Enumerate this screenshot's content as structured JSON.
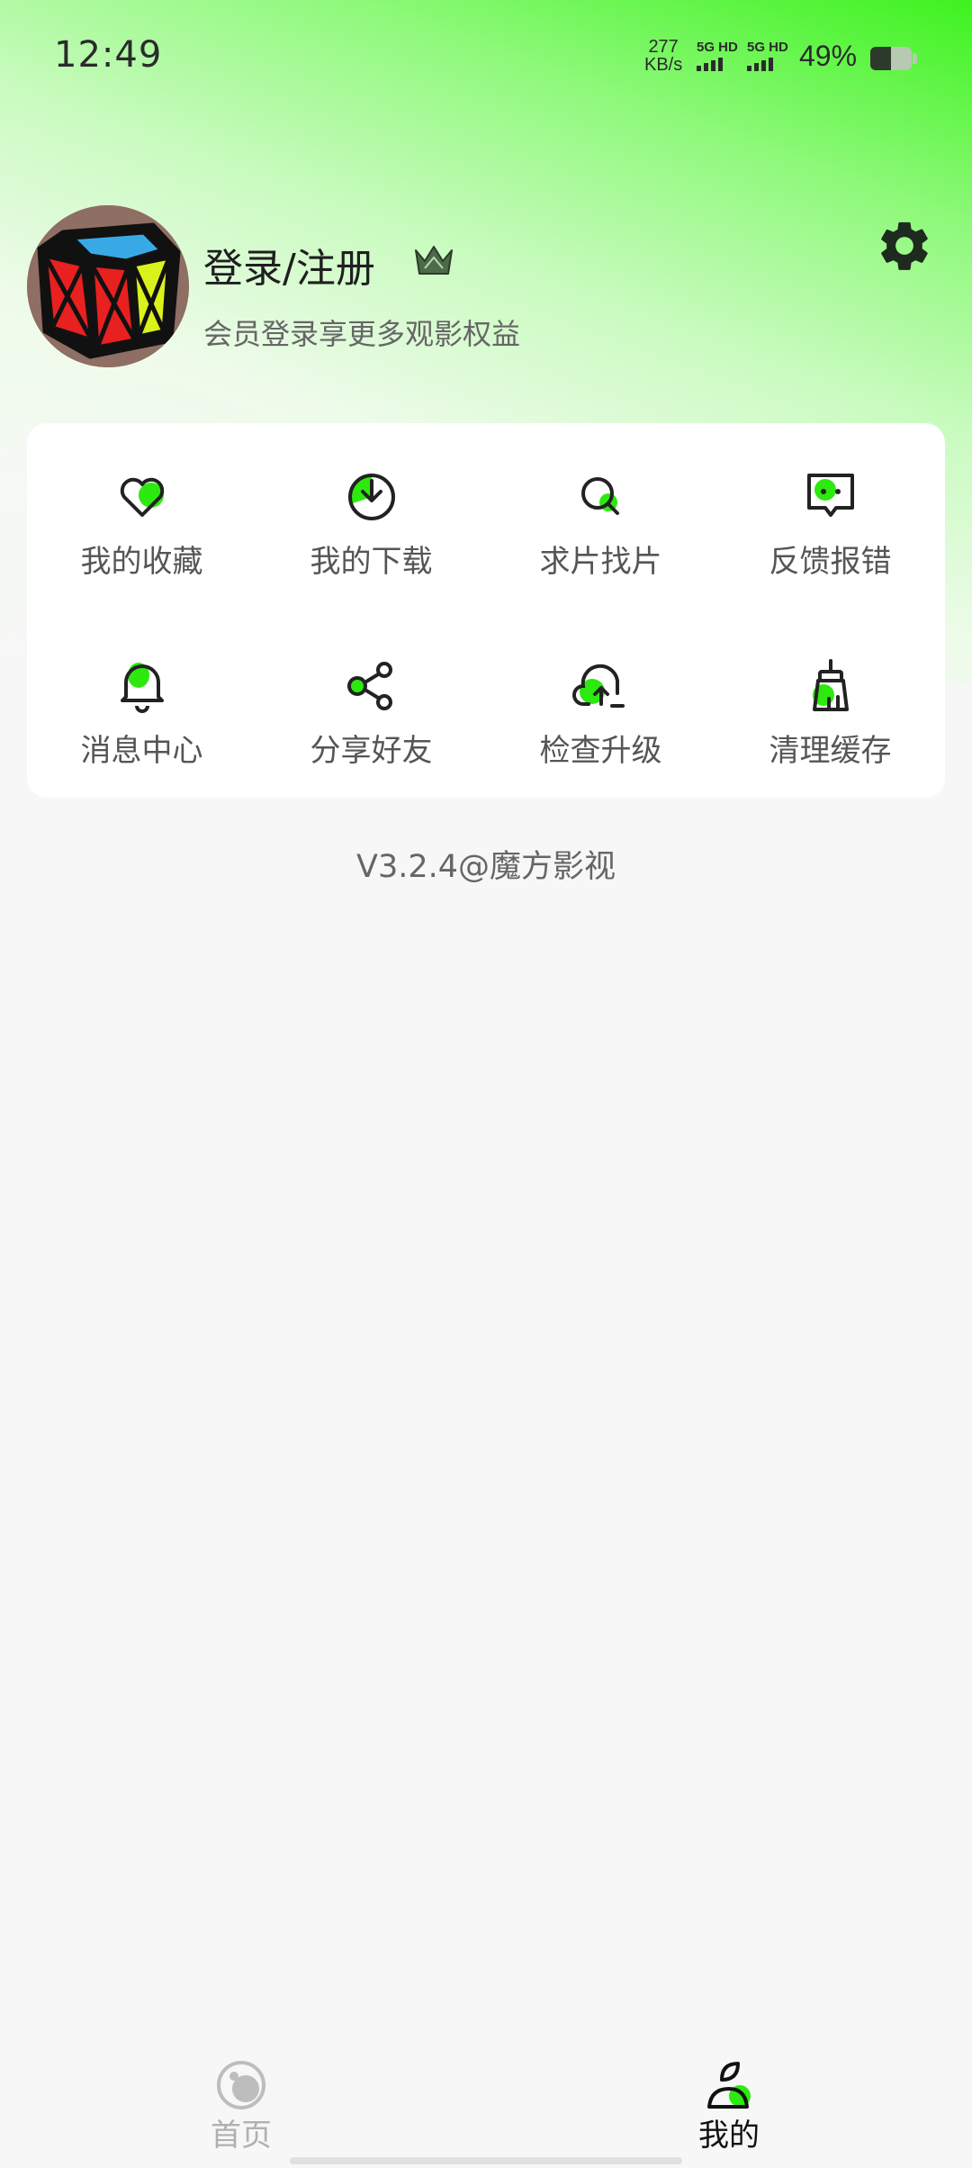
{
  "status_bar": {
    "time": "12:49",
    "net_speed_value": "277",
    "net_speed_unit": "KB/s",
    "sim1_label": "5G HD",
    "sim2_label": "5G HD",
    "battery_percent": "49%",
    "battery_level": 0.49
  },
  "profile": {
    "title": "登录/注册",
    "subtitle": "会员登录享更多观影权益"
  },
  "grid": {
    "favorites": "我的收藏",
    "downloads": "我的下载",
    "request": "求片找片",
    "feedback": "反馈报错",
    "messages": "消息中心",
    "share": "分享好友",
    "update": "检查升级",
    "cache": "清理缓存"
  },
  "version": "V3.2.4@魔方影视",
  "bottom_nav": {
    "home": "首页",
    "mine": "我的"
  },
  "colors": {
    "accent": "#2ee90f",
    "text_dark": "#1f1f1f",
    "text_muted": "#666666",
    "nav_inactive": "#b0b0b0"
  }
}
